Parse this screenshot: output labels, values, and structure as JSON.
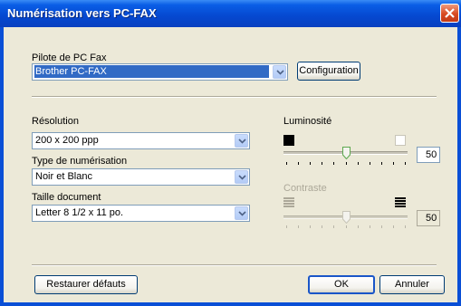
{
  "window": {
    "title": "Numérisation vers PC-FAX"
  },
  "driver": {
    "label": "Pilote de PC Fax",
    "selected": "Brother PC-FAX",
    "config_button": "Configuration"
  },
  "resolution": {
    "label": "Résolution",
    "selected": "200 x 200 ppp"
  },
  "scan_type": {
    "label": "Type de numérisation",
    "selected": "Noir et Blanc"
  },
  "doc_size": {
    "label": "Taille document",
    "selected": "Letter 8 1/2 x 11 po."
  },
  "brightness": {
    "label": "Luminosité",
    "value": "50",
    "level": 0.5
  },
  "contrast": {
    "label": "Contraste",
    "value": "50",
    "level": 0.5,
    "enabled": false
  },
  "buttons": {
    "restore": "Restaurer défauts",
    "ok": "OK",
    "cancel": "Annuler"
  },
  "icons": {
    "close": "close-icon",
    "dropdown": "chevron-down-icon",
    "brightness_low": "black-square-icon",
    "brightness_high": "white-square-icon",
    "contrast_low": "low-contrast-icon",
    "contrast_high": "high-contrast-icon"
  },
  "colors": {
    "titlebar": "#0a4fd6",
    "face": "#ece9d8",
    "selection": "#316ac5"
  }
}
